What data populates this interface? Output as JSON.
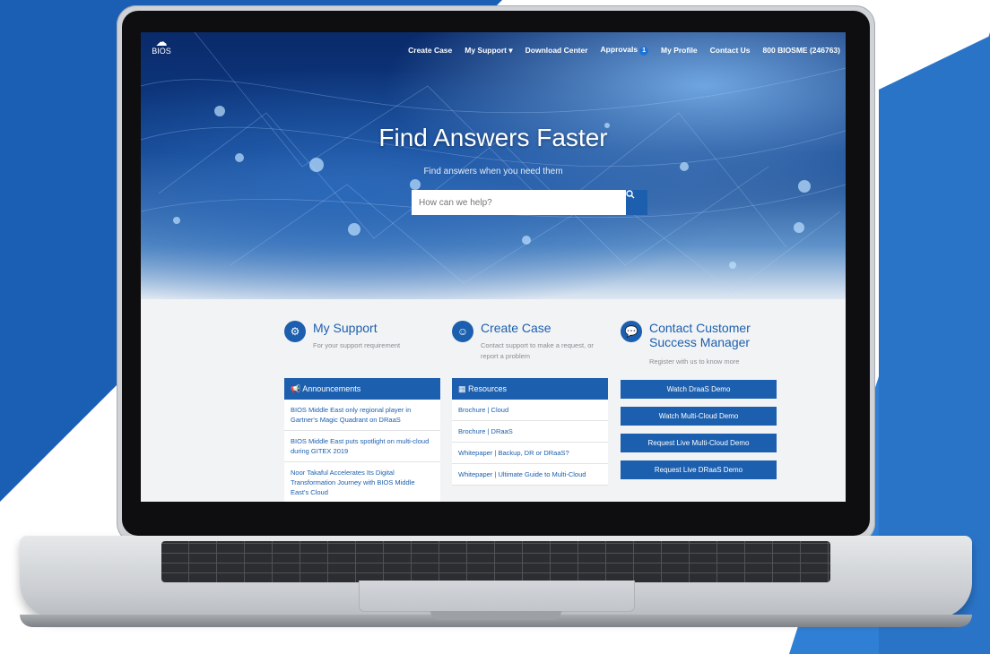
{
  "site": {
    "logo_text": "BIOS",
    "nav": [
      "Create Case",
      "My Support ▾",
      "Download Center",
      "Approvals",
      "My Profile",
      "Contact Us",
      "800 BIOSME (246763)"
    ],
    "approvals_badge": "1"
  },
  "hero": {
    "title": "Find Answers Faster",
    "subtitle": "Find answers when you need them",
    "search_placeholder": "How can we help?"
  },
  "columns": {
    "support": {
      "title": "My Support",
      "desc": "For your support requirement",
      "panel_title": "Announcements",
      "items": [
        "BIOS Middle East only regional player in Gartner's Magic Quadrant on DRaaS",
        "BIOS Middle East puts spotlight on multi-cloud during GITEX 2019",
        "Noor Takaful Accelerates Its Digital Transformation Journey with BIOS Middle East's Cloud"
      ]
    },
    "case": {
      "title": "Create Case",
      "desc": "Contact support to make a request, or report a problem",
      "panel_title": "Resources",
      "items": [
        "Brochure | Cloud",
        "Brochure | DRaaS",
        "Whitepaper | Backup, DR or DRaaS?",
        "Whitepaper | Ultimate Guide to Multi-Cloud"
      ]
    },
    "contact": {
      "title_line1": "Contact Customer",
      "title_line2": "Success Manager",
      "desc": "Register with us to know more",
      "buttons": [
        "Watch DraaS Demo",
        "Watch Multi-Cloud Demo",
        "Request Live Multi-Cloud Demo",
        "Request Live DRaaS Demo"
      ]
    }
  },
  "colors": {
    "brand": "#1c5fae",
    "bg_left": "#1b5fb4",
    "bg_right": "#2f7fd4"
  },
  "icons": [
    "gear-icon",
    "person-icon",
    "chat-icon",
    "megaphone-icon",
    "grid-icon",
    "search-icon"
  ]
}
